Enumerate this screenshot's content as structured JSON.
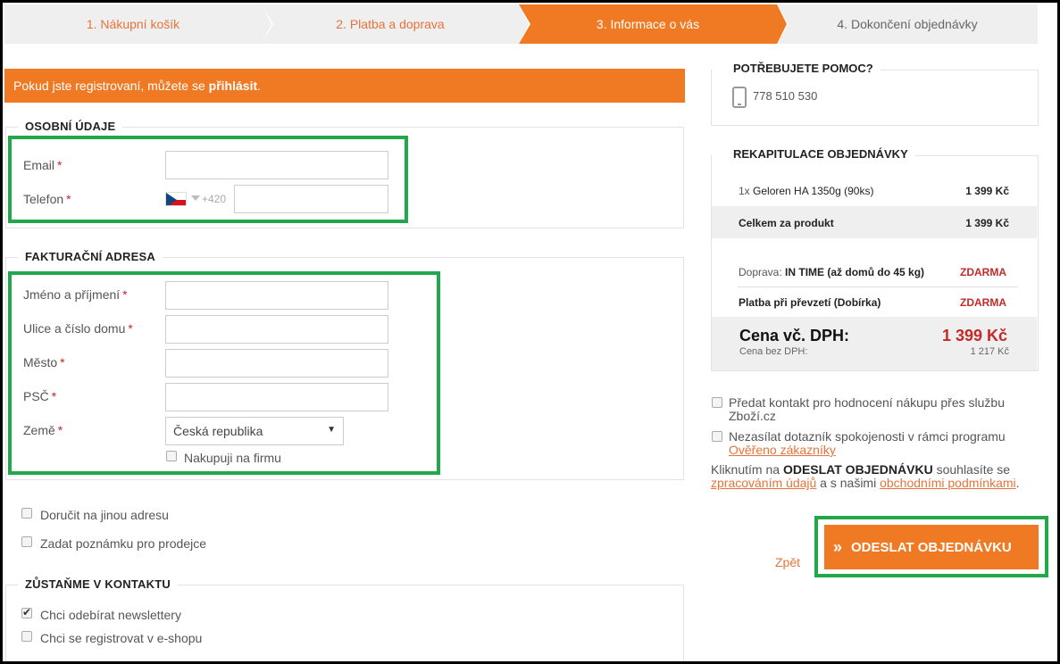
{
  "steps": [
    {
      "label": "1. Nákupní košík"
    },
    {
      "label": "2. Platba a doprava"
    },
    {
      "label": "3. Informace o vás"
    },
    {
      "label": "4. Dokončení objednávky"
    }
  ],
  "banner": {
    "text": "Pokud jste registrovaní, můžete se ",
    "link": "přihlásit",
    "suffix": "."
  },
  "personal": {
    "title": "OSOBNÍ ÚDAJE",
    "email_label": "Email",
    "phone_label": "Telefon",
    "phone_prefix": "+420",
    "required_mark": "*"
  },
  "billing": {
    "title": "FAKTURAČNÍ ADRESA",
    "name_label": "Jméno a příjmení",
    "street_label": "Ulice a číslo domu",
    "city_label": "Město",
    "zip_label": "PSČ",
    "country_label": "Země",
    "country_value": "Česká republika",
    "company_label": "Nakupuji na firmu"
  },
  "options": {
    "other_address": "Doručit na jinou adresu",
    "note": "Zadat poznámku pro prodejce"
  },
  "contact": {
    "title": "ZŮSTAŇME V KONTAKTU",
    "newsletter": "Chci odebírat newslettery",
    "newsletter_checked": true,
    "register": "Chci se registrovat v e-shopu"
  },
  "help": {
    "title": "POTŘEBUJETE POMOC?",
    "phone": "778 510 530"
  },
  "summary": {
    "title": "REKAPITULACE OBJEDNÁVKY",
    "item_qty": "1x",
    "item_name": "Geloren HA 1350g (90ks)",
    "item_price": "1 399 Kč",
    "product_total_label": "Celkem za produkt",
    "product_total": "1 399 Kč",
    "shipping_prefix": "Doprava:",
    "shipping_name": "IN TIME (až domů do 45 kg)",
    "shipping_price": "ZDARMA",
    "payment_label": "Platba při převzetí (Dobírka)",
    "payment_price": "ZDARMA",
    "total_label": "Cena vč. DPH:",
    "total_value": "1 399 Kč",
    "net_label": "Cena bez DPH:",
    "net_value": "1 217 Kč"
  },
  "consents": {
    "zbozi_line1": "Předat kontakt pro hodnocení nákupu přes službu",
    "zbozi_line2": "Zboží.cz",
    "survey_line1": "Nezasílat dotazník spokojenosti v rámci programu",
    "survey_link": "Ověřeno zákazníky"
  },
  "terms": {
    "p1": "Kliknutím na ",
    "bold": "ODESLAT OBJEDNÁVKU",
    "p2": " souhlasíte se",
    "link1": "zpracováním údajů",
    "p3": " a s našimi ",
    "link2": "obchodními podmínkami",
    "p4": "."
  },
  "actions": {
    "back": "Zpět",
    "submit": "ODESLAT OBJEDNÁVKU"
  },
  "colors": {
    "accent": "#f07a24",
    "highlight": "#22a84a",
    "price_red": "#c62828"
  }
}
